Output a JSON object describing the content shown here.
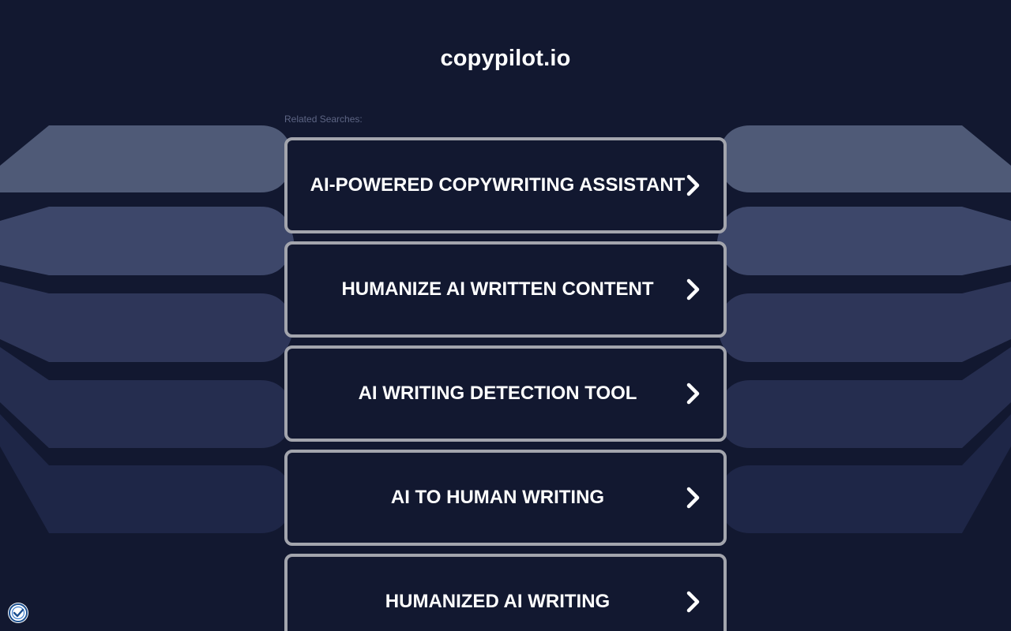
{
  "site": {
    "domain": "copypilot.io"
  },
  "related": {
    "label": "Related Searches:",
    "items": [
      {
        "label": "AI-POWERED COPYWRITING ASSISTANT"
      },
      {
        "label": "HUMANIZE AI WRITTEN CONTENT"
      },
      {
        "label": "AI WRITING DETECTION TOOL"
      },
      {
        "label": "AI TO HUMAN WRITING"
      },
      {
        "label": "HUMANIZED AI WRITING"
      }
    ]
  },
  "icons": {
    "chevron": "chevron-right-icon",
    "privacy": "privacy-badge-icon"
  },
  "colors": {
    "background": "#121830",
    "card_border": "#a3a5ad",
    "text": "#ffffff",
    "label": "#5d6584"
  }
}
